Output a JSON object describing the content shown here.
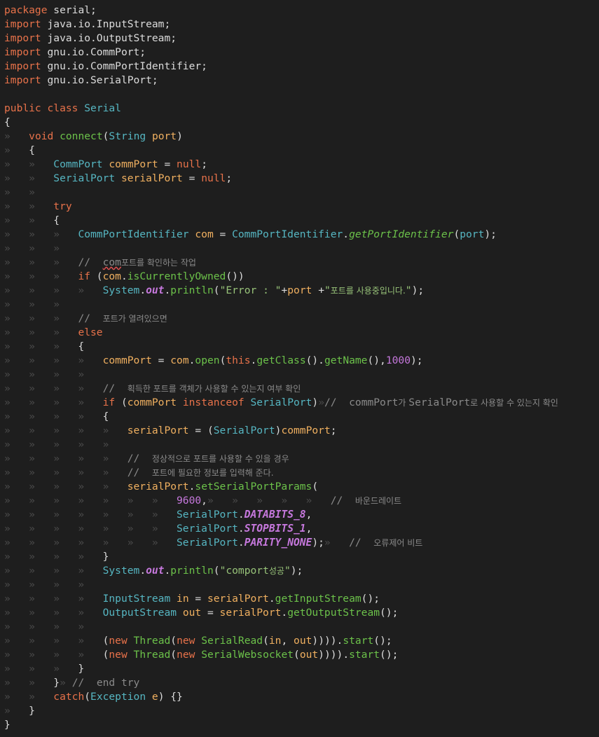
{
  "lines": [
    [
      [
        "kw",
        "package"
      ],
      [
        "plain",
        " serial;"
      ]
    ],
    [
      [
        "kw",
        "import"
      ],
      [
        "plain",
        " java.io.InputStream;"
      ]
    ],
    [
      [
        "kw",
        "import"
      ],
      [
        "plain",
        " java.io.OutputStream;"
      ]
    ],
    [
      [
        "kw",
        "import"
      ],
      [
        "plain",
        " gnu.io.CommPort;"
      ]
    ],
    [
      [
        "kw",
        "import"
      ],
      [
        "plain",
        " gnu.io.CommPortIdentifier;"
      ]
    ],
    [
      [
        "kw",
        "import"
      ],
      [
        "plain",
        " gnu.io.SerialPort;"
      ]
    ],
    [],
    [
      [
        "kw",
        "public"
      ],
      [
        "plain",
        " "
      ],
      [
        "kw",
        "class"
      ],
      [
        "plain",
        " "
      ],
      [
        "type",
        "Serial"
      ]
    ],
    [
      [
        "plain",
        "{"
      ]
    ],
    [
      [
        "tab",
        "»"
      ],
      [
        "plain",
        "   "
      ],
      [
        "kw",
        "void"
      ],
      [
        "plain",
        " "
      ],
      [
        "meth",
        "connect"
      ],
      [
        "plain",
        "("
      ],
      [
        "type",
        "String"
      ],
      [
        "plain",
        " "
      ],
      [
        "ident",
        "port"
      ],
      [
        "plain",
        ")"
      ]
    ],
    [
      [
        "tab",
        "»"
      ],
      [
        "plain",
        "   {"
      ]
    ],
    [
      [
        "tab",
        "»   »"
      ],
      [
        "plain",
        "   "
      ],
      [
        "type",
        "CommPort"
      ],
      [
        "plain",
        " "
      ],
      [
        "ident",
        "commPort"
      ],
      [
        "plain",
        " = "
      ],
      [
        "kw",
        "null"
      ],
      [
        "plain",
        ";"
      ]
    ],
    [
      [
        "tab",
        "»   »"
      ],
      [
        "plain",
        "   "
      ],
      [
        "type",
        "SerialPort"
      ],
      [
        "plain",
        " "
      ],
      [
        "ident",
        "serialPort"
      ],
      [
        "plain",
        " = "
      ],
      [
        "kw",
        "null"
      ],
      [
        "plain",
        ";"
      ]
    ],
    [
      [
        "tab",
        "»   »"
      ]
    ],
    [
      [
        "tab",
        "»   »"
      ],
      [
        "plain",
        "   "
      ],
      [
        "kw",
        "try"
      ]
    ],
    [
      [
        "tab",
        "»   »"
      ],
      [
        "plain",
        "   {"
      ]
    ],
    [
      [
        "tab",
        "»   »   »"
      ],
      [
        "plain",
        "   "
      ],
      [
        "type",
        "CommPortIdentifier"
      ],
      [
        "plain",
        " "
      ],
      [
        "ident",
        "com"
      ],
      [
        "plain",
        " = "
      ],
      [
        "type",
        "CommPortIdentifier"
      ],
      [
        "plain",
        "."
      ],
      [
        "ital",
        "getPortIdentifier"
      ],
      [
        "plain",
        "("
      ],
      [
        "type",
        "port"
      ],
      [
        "plain",
        ");"
      ]
    ],
    [
      [
        "tab",
        "»   »   »"
      ]
    ],
    [
      [
        "tab",
        "»   »   »"
      ],
      [
        "plain",
        "   "
      ],
      [
        "cm",
        "//  "
      ],
      [
        "cm squig",
        "com"
      ],
      [
        "cm-k",
        "포트를 확인하는 작업"
      ]
    ],
    [
      [
        "tab",
        "»   »   »"
      ],
      [
        "plain",
        "   "
      ],
      [
        "kw",
        "if"
      ],
      [
        "plain",
        " ("
      ],
      [
        "ident",
        "com"
      ],
      [
        "plain",
        "."
      ],
      [
        "meth",
        "isCurrentlyOwned"
      ],
      [
        "plain",
        "())"
      ]
    ],
    [
      [
        "tab",
        "»   »   »   »"
      ],
      [
        "plain",
        "   "
      ],
      [
        "type",
        "System"
      ],
      [
        "plain",
        "."
      ],
      [
        "bold",
        "out"
      ],
      [
        "plain",
        "."
      ],
      [
        "meth",
        "println"
      ],
      [
        "plain",
        "("
      ],
      [
        "str",
        "\"Error : \""
      ],
      [
        "plain",
        "+"
      ],
      [
        "ident",
        "port"
      ],
      [
        "plain",
        " +"
      ],
      [
        "str",
        "\""
      ],
      [
        "str-k",
        "포트를 사용중입니다."
      ],
      [
        "str",
        "\""
      ],
      [
        "plain",
        ");"
      ]
    ],
    [
      [
        "tab",
        "»   »   »"
      ]
    ],
    [
      [
        "tab",
        "»   »   »"
      ],
      [
        "plain",
        "   "
      ],
      [
        "cm",
        "//  "
      ],
      [
        "cm-k",
        "포트가 열려있으면"
      ]
    ],
    [
      [
        "tab",
        "»   »   »"
      ],
      [
        "plain",
        "   "
      ],
      [
        "kw",
        "else"
      ]
    ],
    [
      [
        "tab",
        "»   »   »"
      ],
      [
        "plain",
        "   {"
      ]
    ],
    [
      [
        "tab",
        "»   »   »   »"
      ],
      [
        "plain",
        "   "
      ],
      [
        "ident",
        "commPort"
      ],
      [
        "plain",
        " = "
      ],
      [
        "ident",
        "com"
      ],
      [
        "plain",
        "."
      ],
      [
        "meth",
        "open"
      ],
      [
        "plain",
        "("
      ],
      [
        "kw",
        "this"
      ],
      [
        "plain",
        "."
      ],
      [
        "meth",
        "getClass"
      ],
      [
        "plain",
        "()."
      ],
      [
        "meth",
        "getName"
      ],
      [
        "plain",
        "(),"
      ],
      [
        "num",
        "1000"
      ],
      [
        "plain",
        ");"
      ]
    ],
    [
      [
        "tab",
        "»   »   »   »"
      ]
    ],
    [
      [
        "tab",
        "»   »   »   »"
      ],
      [
        "plain",
        "   "
      ],
      [
        "cm",
        "//  "
      ],
      [
        "cm-k",
        "획득한 포트를 객체가 사용할 수 있는지 여부 확인"
      ]
    ],
    [
      [
        "tab",
        "»   »   »   »"
      ],
      [
        "plain",
        "   "
      ],
      [
        "kw",
        "if"
      ],
      [
        "plain",
        " ("
      ],
      [
        "ident",
        "commPort"
      ],
      [
        "plain",
        " "
      ],
      [
        "kw",
        "instanceof"
      ],
      [
        "plain",
        " "
      ],
      [
        "type",
        "SerialPort"
      ],
      [
        "plain",
        ")"
      ],
      [
        "tab",
        "»"
      ],
      [
        "cm",
        "//  commPort"
      ],
      [
        "cm-k",
        "가 "
      ],
      [
        "cm",
        "SerialPort"
      ],
      [
        "cm-k",
        "로 사용할 수 있는지 확인"
      ]
    ],
    [
      [
        "tab",
        "»   »   »   »"
      ],
      [
        "plain",
        "   {"
      ]
    ],
    [
      [
        "tab",
        "»   »   »   »   »"
      ],
      [
        "plain",
        "   "
      ],
      [
        "ident",
        "serialPort"
      ],
      [
        "plain",
        " = ("
      ],
      [
        "type",
        "SerialPort"
      ],
      [
        "plain",
        ")"
      ],
      [
        "ident",
        "commPort"
      ],
      [
        "plain",
        ";"
      ]
    ],
    [
      [
        "tab",
        "»   »   »   »   »"
      ]
    ],
    [
      [
        "tab",
        "»   »   »   »   »"
      ],
      [
        "plain",
        "   "
      ],
      [
        "cm",
        "//  "
      ],
      [
        "cm-k",
        "정상적으로 포트를 사용할 수 있을 경우"
      ]
    ],
    [
      [
        "tab",
        "»   »   »   »   »"
      ],
      [
        "plain",
        "   "
      ],
      [
        "cm",
        "//  "
      ],
      [
        "cm-k",
        "포트에 필요한 정보를 입력해 준다."
      ]
    ],
    [
      [
        "tab",
        "»   »   »   »   »"
      ],
      [
        "plain",
        "   "
      ],
      [
        "ident",
        "serialPort"
      ],
      [
        "plain",
        "."
      ],
      [
        "meth",
        "setSerialPortParams"
      ],
      [
        "plain",
        "("
      ]
    ],
    [
      [
        "tab",
        "»   »   »   »   »   »   »"
      ],
      [
        "plain",
        "   "
      ],
      [
        "num",
        "9600"
      ],
      [
        "plain",
        ","
      ],
      [
        "tab",
        "»   »   »   »   »"
      ],
      [
        "plain",
        "   "
      ],
      [
        "cm",
        "//  "
      ],
      [
        "cm-k",
        "바운드레이트"
      ]
    ],
    [
      [
        "tab",
        "»   »   »   »   »   »   »"
      ],
      [
        "plain",
        "   "
      ],
      [
        "type",
        "SerialPort"
      ],
      [
        "plain",
        "."
      ],
      [
        "const",
        "DATABITS_8"
      ],
      [
        "plain",
        ","
      ]
    ],
    [
      [
        "tab",
        "»   »   »   »   »   »   »"
      ],
      [
        "plain",
        "   "
      ],
      [
        "type",
        "SerialPort"
      ],
      [
        "plain",
        "."
      ],
      [
        "const",
        "STOPBITS_1"
      ],
      [
        "plain",
        ","
      ]
    ],
    [
      [
        "tab",
        "»   »   »   »   »   »   »"
      ],
      [
        "plain",
        "   "
      ],
      [
        "type",
        "SerialPort"
      ],
      [
        "plain",
        "."
      ],
      [
        "const",
        "PARITY_NONE"
      ],
      [
        "plain",
        ");"
      ],
      [
        "tab",
        "»"
      ],
      [
        "plain",
        "   "
      ],
      [
        "cm",
        "//  "
      ],
      [
        "cm-k",
        "오류제어 비트"
      ]
    ],
    [
      [
        "tab",
        "»   »   »   »"
      ],
      [
        "plain",
        "   }"
      ]
    ],
    [
      [
        "tab",
        "»   »   »   »"
      ],
      [
        "plain",
        "   "
      ],
      [
        "type",
        "System"
      ],
      [
        "plain",
        "."
      ],
      [
        "bold",
        "out"
      ],
      [
        "plain",
        "."
      ],
      [
        "meth",
        "println"
      ],
      [
        "plain",
        "("
      ],
      [
        "str",
        "\"comport"
      ],
      [
        "str-k",
        "성공"
      ],
      [
        "str",
        "\""
      ],
      [
        "plain",
        ");"
      ]
    ],
    [
      [
        "tab",
        "»   »   »   »"
      ]
    ],
    [
      [
        "tab",
        "»   »   »   »"
      ],
      [
        "plain",
        "   "
      ],
      [
        "type",
        "InputStream"
      ],
      [
        "plain",
        " "
      ],
      [
        "ident",
        "in"
      ],
      [
        "plain",
        " = "
      ],
      [
        "ident",
        "serialPort"
      ],
      [
        "plain",
        "."
      ],
      [
        "meth",
        "getInputStream"
      ],
      [
        "plain",
        "();"
      ]
    ],
    [
      [
        "tab",
        "»   »   »   »"
      ],
      [
        "plain",
        "   "
      ],
      [
        "type",
        "OutputStream"
      ],
      [
        "plain",
        " "
      ],
      [
        "ident",
        "out"
      ],
      [
        "plain",
        " = "
      ],
      [
        "ident",
        "serialPort"
      ],
      [
        "plain",
        "."
      ],
      [
        "meth",
        "getOutputStream"
      ],
      [
        "plain",
        "();"
      ]
    ],
    [
      [
        "tab",
        "»   »   »   »"
      ]
    ],
    [
      [
        "tab",
        "»   »   »   »"
      ],
      [
        "plain",
        "   ("
      ],
      [
        "kw",
        "new"
      ],
      [
        "plain",
        " "
      ],
      [
        "meth",
        "Thread"
      ],
      [
        "plain",
        "("
      ],
      [
        "kw",
        "new"
      ],
      [
        "plain",
        " "
      ],
      [
        "meth",
        "SerialRead"
      ],
      [
        "plain",
        "("
      ],
      [
        "ident",
        "in"
      ],
      [
        "plain",
        ", "
      ],
      [
        "ident",
        "out"
      ],
      [
        "plain",
        "))))."
      ],
      [
        "meth",
        "start"
      ],
      [
        "plain",
        "();"
      ]
    ],
    [
      [
        "tab",
        "»   »   »   »"
      ],
      [
        "plain",
        "   ("
      ],
      [
        "kw",
        "new"
      ],
      [
        "plain",
        " "
      ],
      [
        "meth",
        "Thread"
      ],
      [
        "plain",
        "("
      ],
      [
        "kw",
        "new"
      ],
      [
        "plain",
        " "
      ],
      [
        "meth",
        "SerialWebsocket"
      ],
      [
        "plain",
        "("
      ],
      [
        "ident",
        "out"
      ],
      [
        "plain",
        "))))."
      ],
      [
        "meth",
        "start"
      ],
      [
        "plain",
        "();"
      ]
    ],
    [
      [
        "tab",
        "»   »   »"
      ],
      [
        "plain",
        "   }"
      ]
    ],
    [
      [
        "tab",
        "»   »"
      ],
      [
        "plain",
        "   }"
      ],
      [
        "tab",
        "»"
      ],
      [
        "plain",
        " "
      ],
      [
        "cm",
        "//  end try"
      ]
    ],
    [
      [
        "tab",
        "»   »"
      ],
      [
        "plain",
        "   "
      ],
      [
        "kw",
        "catch"
      ],
      [
        "plain",
        "("
      ],
      [
        "type",
        "Exception"
      ],
      [
        "plain",
        " "
      ],
      [
        "ident",
        "e"
      ],
      [
        "plain",
        ") {}"
      ]
    ],
    [
      [
        "tab",
        "»"
      ],
      [
        "plain",
        "   }"
      ]
    ],
    [
      [
        "plain",
        "}"
      ]
    ]
  ],
  "colors": {
    "background": "#1e1e1e",
    "keyword": "#e8724a",
    "type": "#56b6c2",
    "identifier": "#f0b060",
    "method": "#6cc24a",
    "string": "#98c379",
    "comment": "#8a8a8a",
    "number": "#c678dd"
  }
}
